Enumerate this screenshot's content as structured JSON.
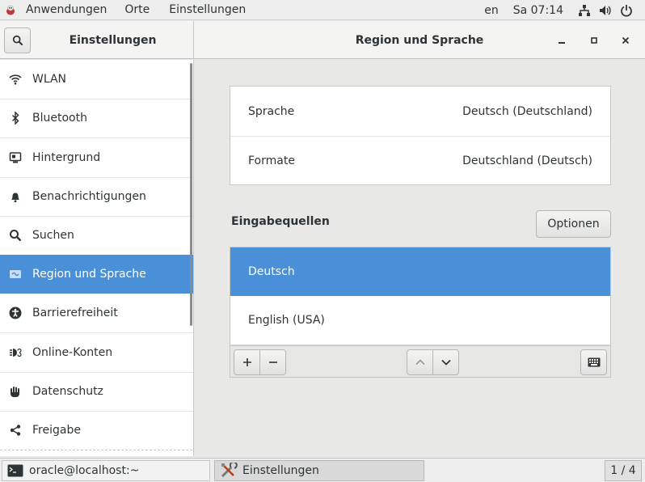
{
  "topbar": {
    "menus": [
      "Anwendungen",
      "Orte",
      "Einstellungen"
    ],
    "lang": "en",
    "clock": "Sa 07:14"
  },
  "headerbar": {
    "left_title": "Einstellungen",
    "title": "Region und Sprache"
  },
  "sidebar": {
    "items": [
      {
        "label": "WLAN",
        "icon": "wifi-icon"
      },
      {
        "label": "Bluetooth",
        "icon": "bluetooth-icon"
      },
      {
        "label": "Hintergrund",
        "icon": "background-icon"
      },
      {
        "label": "Benachrichtigungen",
        "icon": "bell-icon"
      },
      {
        "label": "Suchen",
        "icon": "search-icon"
      },
      {
        "label": "Region und Sprache",
        "icon": "flag-icon",
        "active": true
      },
      {
        "label": "Barrierefreiheit",
        "icon": "accessibility-icon"
      },
      {
        "label": "Online-Konten",
        "icon": "online-accounts-icon"
      },
      {
        "label": "Datenschutz",
        "icon": "privacy-hand-icon"
      },
      {
        "label": "Freigabe",
        "icon": "share-icon"
      }
    ]
  },
  "region": {
    "language_label": "Sprache",
    "language_value": "Deutsch (Deutschland)",
    "formats_label": "Formate",
    "formats_value": "Deutschland (Deutsch)"
  },
  "input_sources": {
    "title": "Eingabequellen",
    "options_label": "Optionen",
    "items": [
      "Deutsch",
      "English (USA)"
    ],
    "selected_index": 0
  },
  "taskbar": {
    "terminal_label": "oracle@localhost:~",
    "settings_label": "Einstellungen",
    "workspace": "1 / 4"
  },
  "colors": {
    "accent": "#4a90d9"
  }
}
